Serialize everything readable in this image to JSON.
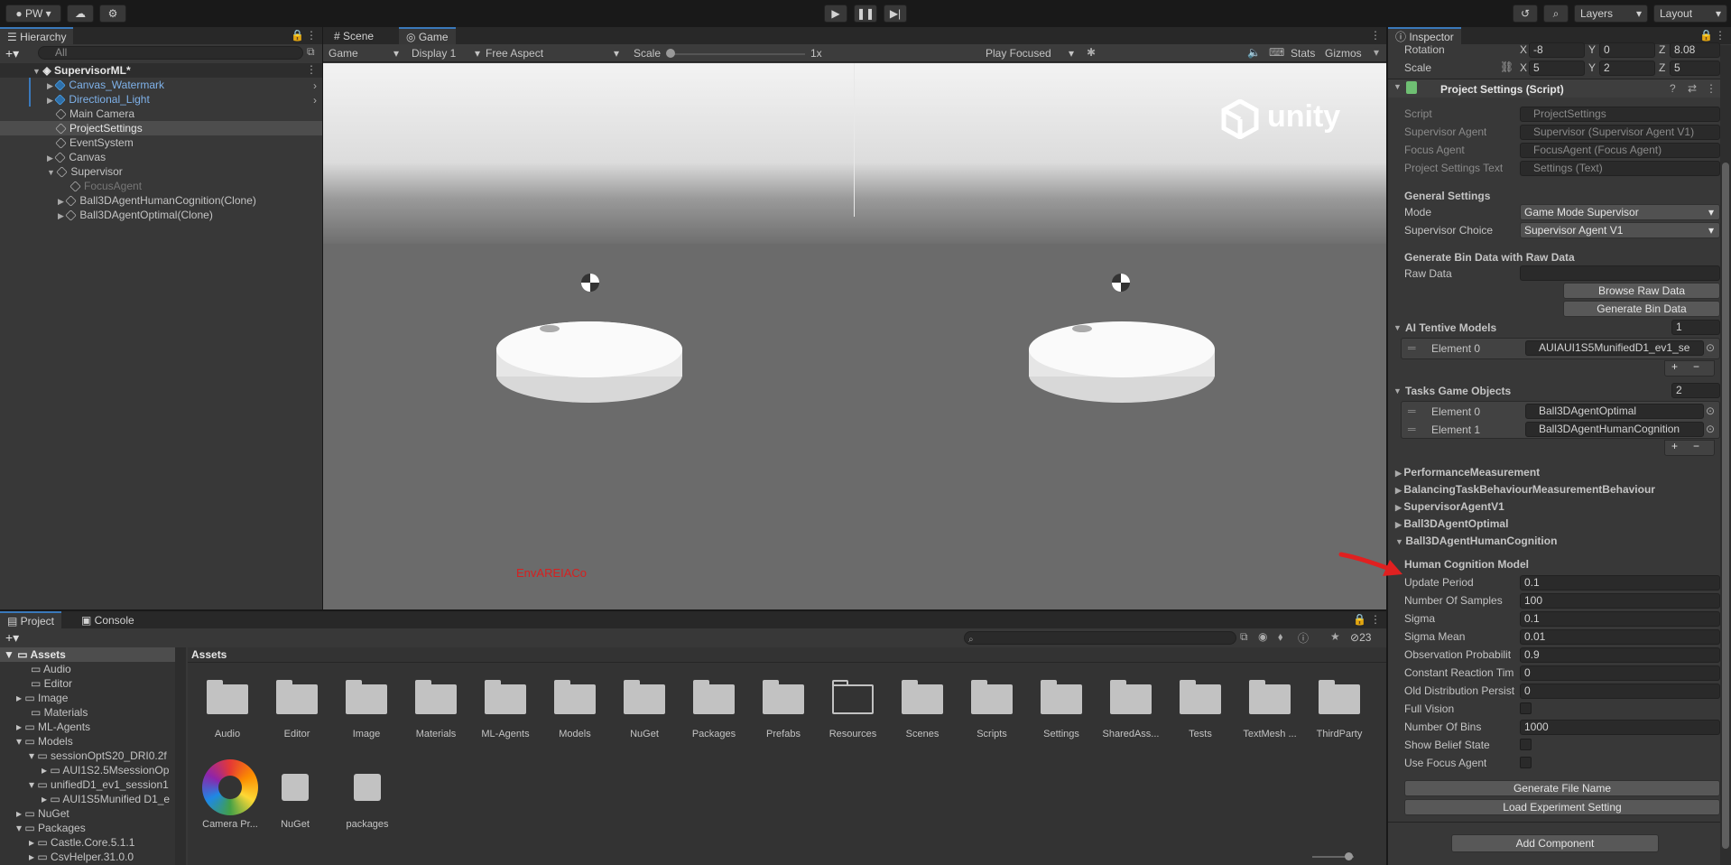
{
  "toolbar": {
    "account": "PW",
    "play_icon": "play-icon",
    "pause_icon": "pause-icon",
    "step_icon": "step-icon",
    "layers": "Layers",
    "layout": "Layout"
  },
  "hierarchy": {
    "tab": "Hierarchy",
    "search_placeholder": "All",
    "scene": "SupervisorML*",
    "items": [
      "Canvas_Watermark",
      "Directional_Light",
      "Main Camera",
      "ProjectSettings",
      "EventSystem",
      "Canvas",
      "Supervisor",
      "FocusAgent",
      "Ball3DAgentHumanCognition(Clone)",
      "Ball3DAgentOptimal(Clone)"
    ]
  },
  "scene": {
    "tab_scene": "Scene",
    "tab_game": "Game",
    "game_dropdown": "Game",
    "display": "Display 1",
    "aspect": "Free Aspect",
    "scale_label": "Scale",
    "scale_value": "1x",
    "play_focused": "Play Focused",
    "stats": "Stats",
    "gizmos": "Gizmos",
    "logo_text": "unity",
    "overlay_text": "EnvAREIACo"
  },
  "project": {
    "tab_project": "Project",
    "tab_console": "Console",
    "hidden_count": "23",
    "breadcrumb": "Assets",
    "tree": [
      "Assets",
      "Audio",
      "Editor",
      "Image",
      "Materials",
      "ML-Agents",
      "Models",
      "sessionOptS20_DRI0.2f",
      "AUI1S2.5MsessionOp",
      "unifiedD1_ev1_session1",
      "AUI1S5Munified D1_e",
      "NuGet",
      "Packages",
      "Castle.Core.5.1.1",
      "CsvHelper.31.0.0"
    ],
    "assets_row1": [
      "Audio",
      "Editor",
      "Image",
      "Materials",
      "ML-Agents",
      "Models",
      "NuGet",
      "Packages",
      "Prefabs",
      "Resources",
      "Scenes",
      "Scripts",
      "Settings",
      "SharedAss...",
      "Tests",
      "TextMesh ...",
      "ThirdParty"
    ],
    "assets_row2": [
      "Camera Pr...",
      "NuGet",
      "packages"
    ]
  },
  "inspector": {
    "tab": "Inspector",
    "rotation": {
      "label": "Rotation",
      "x": "-8",
      "y": "0",
      "z": "8.08"
    },
    "scale": {
      "label": "Scale",
      "x": "5",
      "y": "2",
      "z": "5"
    },
    "component_title": "Project Settings (Script)",
    "script": {
      "label": "Script",
      "value": "ProjectSettings"
    },
    "supervisor_agent": {
      "label": "Supervisor Agent",
      "value": "Supervisor (Supervisor Agent V1)"
    },
    "focus_agent": {
      "label": "Focus Agent",
      "value": "FocusAgent (Focus Agent)"
    },
    "settings_text": {
      "label": "Project Settings Text",
      "value": "Settings (Text)"
    },
    "general_header": "General Settings",
    "mode": {
      "label": "Mode",
      "value": "Game Mode Supervisor"
    },
    "supervisor_choice": {
      "label": "Supervisor Choice",
      "value": "Supervisor Agent V1"
    },
    "bin_header": "Generate Bin Data with Raw Data",
    "raw_data": {
      "label": "Raw Data",
      "value": ""
    },
    "browse_btn": "Browse Raw Data",
    "generate_bin_btn": "Generate Bin Data",
    "ai_models": {
      "label": "AI Tentive Models",
      "count": "1",
      "el0_label": "Element 0",
      "el0_value": "AUIAUI1S5MunifiedD1_ev1_se"
    },
    "tasks": {
      "label": "Tasks Game Objects",
      "count": "2",
      "el0_label": "Element 0",
      "el0_value": "Ball3DAgentOptimal",
      "el1_label": "Element 1",
      "el1_value": "Ball3DAgentHumanCognition"
    },
    "plus": "+",
    "minus": "−",
    "foldouts": [
      "PerformanceMeasurement",
      "BalancingTaskBehaviourMeasurementBehaviour",
      "SupervisorAgentV1",
      "Ball3DAgentOptimal",
      "Ball3DAgentHumanCognition"
    ],
    "hcm_header": "Human Cognition Model",
    "hcm": [
      {
        "label": "Update Period",
        "value": "0.1"
      },
      {
        "label": "Number Of Samples",
        "value": "100"
      },
      {
        "label": "Sigma",
        "value": "0.1"
      },
      {
        "label": "Sigma Mean",
        "value": "0.01"
      },
      {
        "label": "Observation Probabilit",
        "value": "0.9"
      },
      {
        "label": "Constant Reaction Tim",
        "value": "0"
      },
      {
        "label": "Old Distribution Persist",
        "value": "0"
      }
    ],
    "full_vision": "Full Vision",
    "bins": {
      "label": "Number Of Bins",
      "value": "1000"
    },
    "belief": "Show Belief State",
    "use_focus": "Use Focus Agent",
    "gen_file_btn": "Generate File Name",
    "load_exp_btn": "Load Experiment Setting",
    "add_component": "Add Component"
  },
  "colors": {
    "accent": "#3a79bb",
    "arrow": "#e02020",
    "overlay_text": "#d62020"
  }
}
